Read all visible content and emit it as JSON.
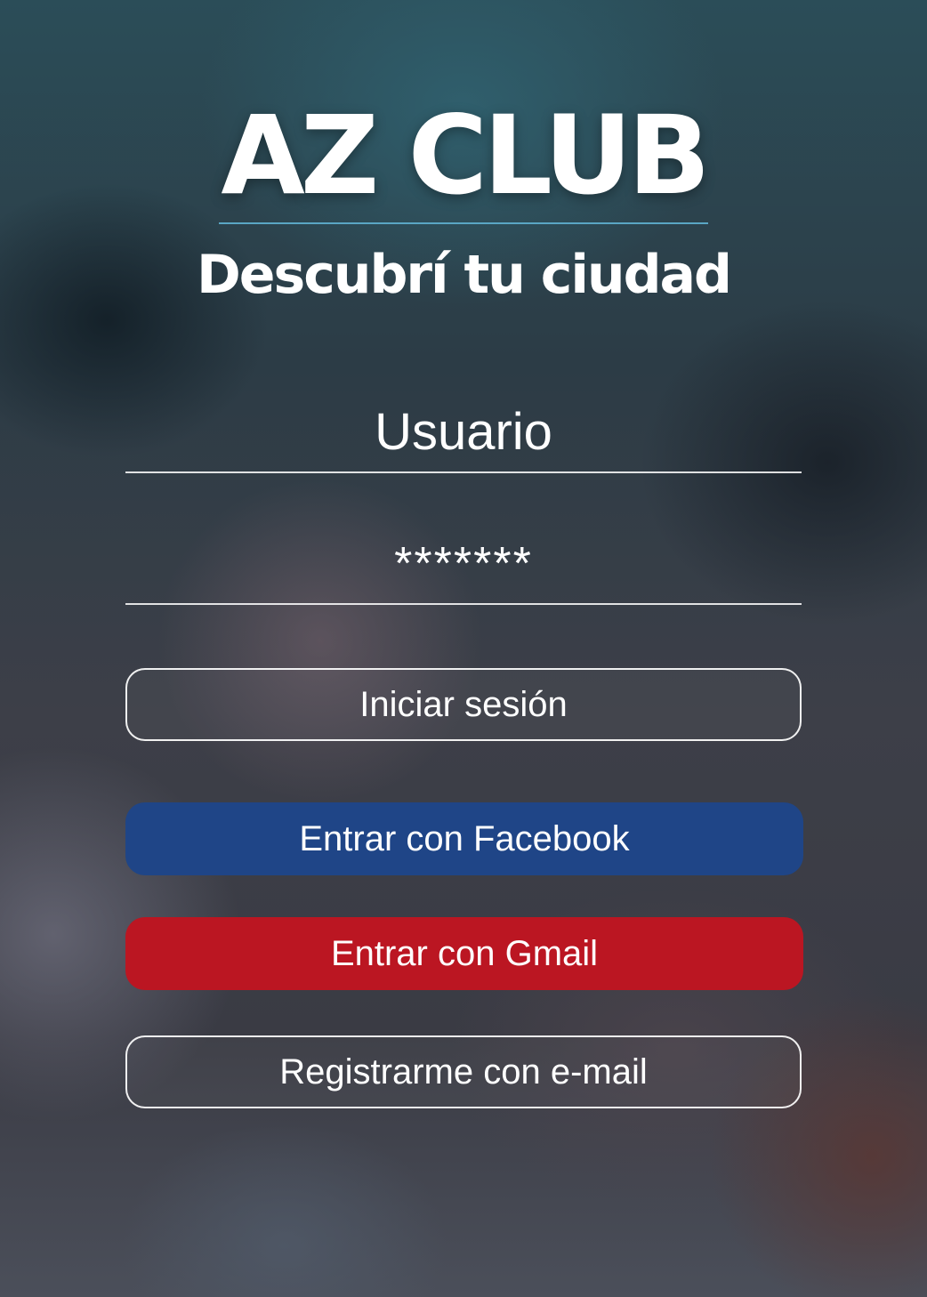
{
  "brand": {
    "title": "AZ CLUB",
    "subtitle": "Descubrí tu ciudad"
  },
  "login_form": {
    "username": {
      "value": "",
      "placeholder": "Usuario"
    },
    "password": {
      "value": "*******",
      "placeholder": ""
    }
  },
  "buttons": {
    "login_label": "Iniciar sesión",
    "facebook_label": "Entrar con Facebook",
    "gmail_label": "Entrar con Gmail",
    "register_label": "Registrarme con e-mail"
  },
  "colors": {
    "facebook": "#1f4587",
    "gmail": "#bb1622",
    "divider_accent": "#5aa6c4"
  }
}
